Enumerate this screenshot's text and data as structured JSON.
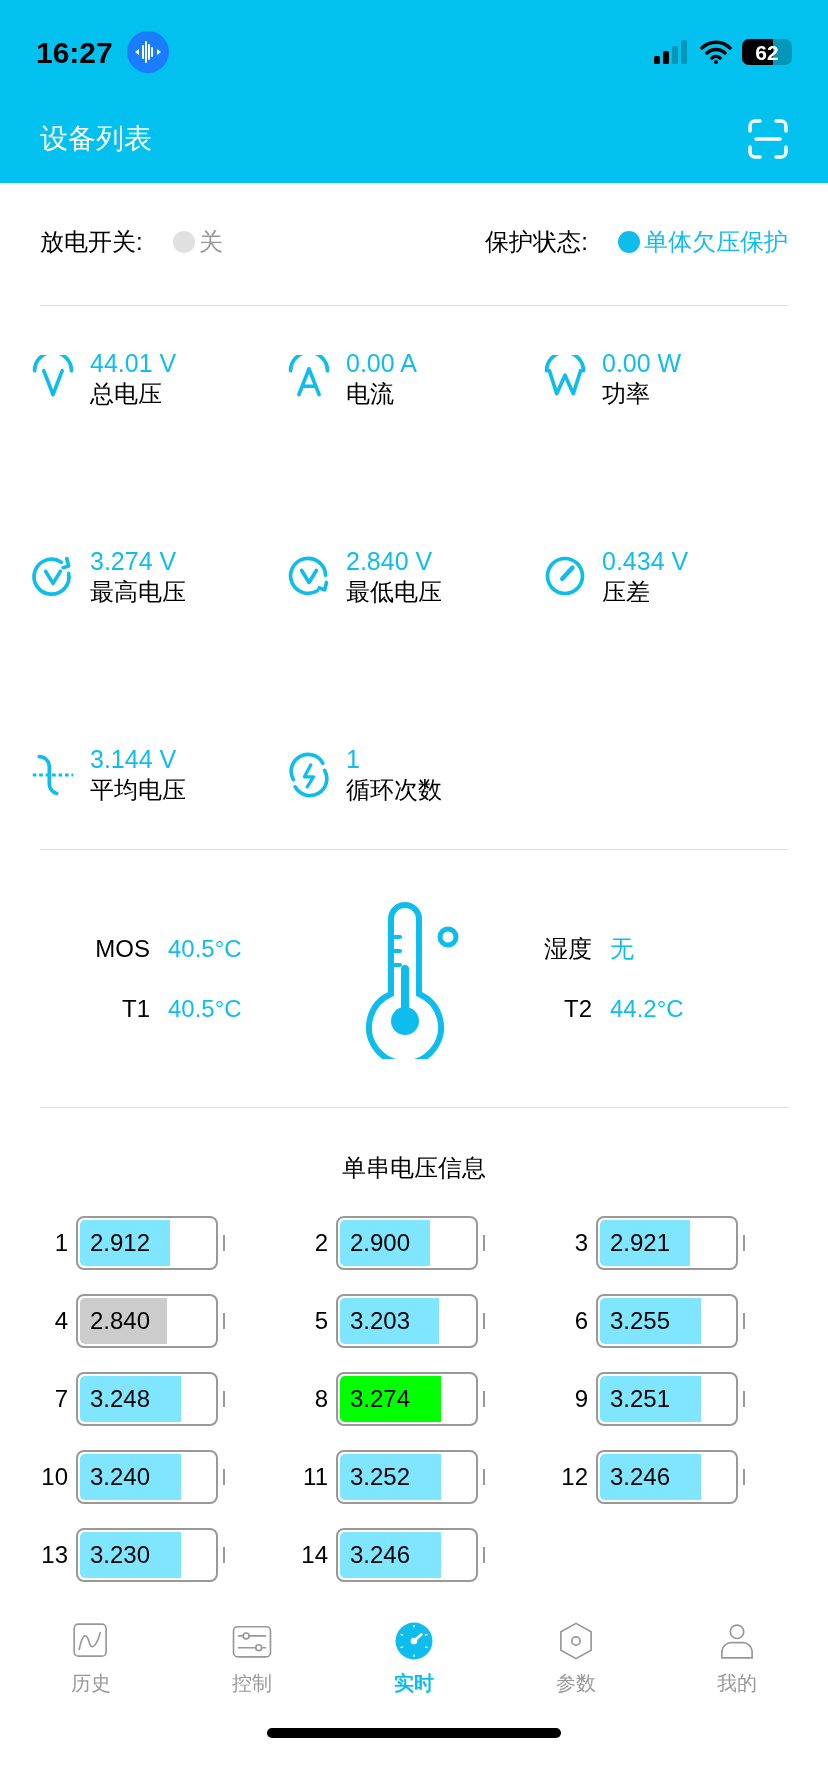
{
  "status_bar": {
    "time": "16:27",
    "battery": "62"
  },
  "header": {
    "title": "设备列表"
  },
  "states": [
    {
      "label": "放电开关:",
      "value": "关",
      "on": false
    },
    {
      "label": "保护状态:",
      "value": "单体欠压保护",
      "on": true
    }
  ],
  "metrics": [
    {
      "kind": "total-voltage",
      "value": "44.01 V",
      "label": "总电压"
    },
    {
      "kind": "current",
      "value": "0.00 A",
      "label": "电流"
    },
    {
      "kind": "power",
      "value": "0.00 W",
      "label": "功率"
    },
    {
      "kind": "max-voltage",
      "value": "3.274 V",
      "label": "最高电压"
    },
    {
      "kind": "min-voltage",
      "value": "2.840 V",
      "label": "最低电压"
    },
    {
      "kind": "difference",
      "value": "0.434 V",
      "label": "压差"
    },
    {
      "kind": "average",
      "value": "3.144 V",
      "label": "平均电压"
    },
    {
      "kind": "cycles",
      "value": "1",
      "label": "循环次数"
    }
  ],
  "temperatures": {
    "left": [
      {
        "label": "MOS",
        "value": "40.5°C"
      },
      {
        "label": "T1",
        "value": "40.5°C"
      }
    ],
    "right": [
      {
        "label": "湿度",
        "value": "无"
      },
      {
        "label": "T2",
        "value": "44.2°C"
      }
    ]
  },
  "cells_title": "单串电压信息",
  "cells": [
    {
      "index": "1",
      "value": "2.912",
      "level": 0.67,
      "color": "#80e5ff"
    },
    {
      "index": "2",
      "value": "2.900",
      "level": 0.67,
      "color": "#80e5ff"
    },
    {
      "index": "3",
      "value": "2.921",
      "level": 0.67,
      "color": "#80e5ff"
    },
    {
      "index": "4",
      "value": "2.840",
      "level": 0.65,
      "color": "#cccccc"
    },
    {
      "index": "5",
      "value": "3.203",
      "level": 0.74,
      "color": "#80e5ff"
    },
    {
      "index": "6",
      "value": "3.255",
      "level": 0.75,
      "color": "#80e5ff"
    },
    {
      "index": "7",
      "value": "3.248",
      "level": 0.75,
      "color": "#80e5ff"
    },
    {
      "index": "8",
      "value": "3.274",
      "level": 0.75,
      "color": "#00ff00"
    },
    {
      "index": "9",
      "value": "3.251",
      "level": 0.75,
      "color": "#80e5ff"
    },
    {
      "index": "10",
      "value": "3.240",
      "level": 0.75,
      "color": "#80e5ff"
    },
    {
      "index": "11",
      "value": "3.252",
      "level": 0.75,
      "color": "#80e5ff"
    },
    {
      "index": "12",
      "value": "3.246",
      "level": 0.75,
      "color": "#80e5ff"
    },
    {
      "index": "13",
      "value": "3.230",
      "level": 0.75,
      "color": "#80e5ff"
    },
    {
      "index": "14",
      "value": "3.246",
      "level": 0.75,
      "color": "#80e5ff"
    }
  ],
  "tabs": [
    {
      "kind": "history",
      "label": "历史",
      "selected": false
    },
    {
      "kind": "control",
      "label": "控制",
      "selected": false
    },
    {
      "kind": "realtime",
      "label": "实时",
      "selected": true
    },
    {
      "kind": "params",
      "label": "参数",
      "selected": false
    },
    {
      "kind": "mine",
      "label": "我的",
      "selected": false
    }
  ]
}
